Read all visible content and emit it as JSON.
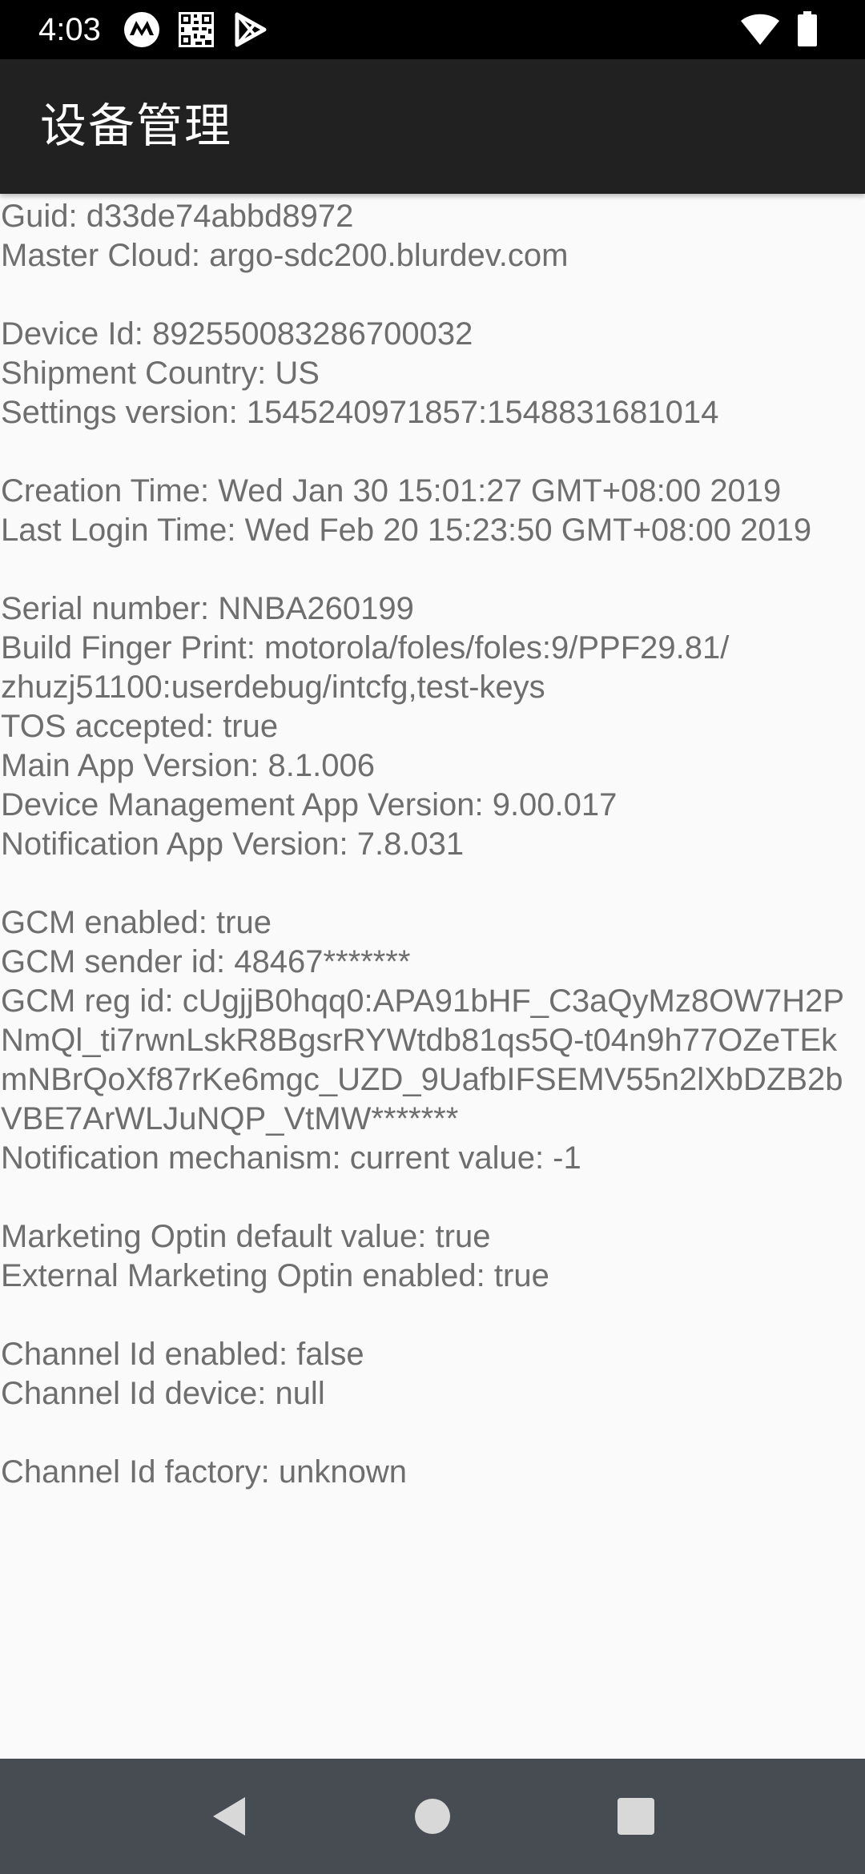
{
  "status_bar": {
    "time": "4:03",
    "icons": [
      "motorola-logo-icon",
      "qr-code-icon",
      "play-store-icon",
      "wifi-icon",
      "battery-icon"
    ]
  },
  "app_bar": {
    "title": "设备管理"
  },
  "info": {
    "guid": "Guid: d33de74abbd8972",
    "master_cloud": "Master Cloud: argo-sdc200.blurdev.com",
    "device_id": "Device Id: 892550083286700032",
    "shipment_country": "Shipment Country: US",
    "settings_version": "Settings version: 1545240971857:1548831681014",
    "creation_time": "Creation Time: Wed Jan 30 15:01:27 GMT+08:00 2019",
    "last_login_time": "Last Login Time: Wed Feb 20 15:23:50 GMT+08:00 2019",
    "serial_number": "Serial number: NNBA260199",
    "build_fingerprint_1": "Build Finger Print: motorola/foles/foles:9/PPF29.81/",
    "build_fingerprint_2": "zhuzj51100:userdebug/intcfg,test-keys",
    "tos_accepted": "TOS accepted: true",
    "main_app_version": "Main App Version: 8.1.006",
    "device_mgmt_app_version": "Device Management App Version: 9.00.017",
    "notification_app_version": "Notification App Version: 7.8.031",
    "gcm_enabled": "GCM enabled: true",
    "gcm_sender_id": "GCM sender id: 48467*******",
    "gcm_reg_id_1": "GCM reg id: cUgjjB0hqq0:APA91bHF_C3aQyMz8OW7H2P",
    "gcm_reg_id_2": "NmQl_ti7rwnLskR8BgsrRYWtdb81qs5Q-t04n9h77OZeTEk",
    "gcm_reg_id_3": "mNBrQoXf87rKe6mgc_UZD_9UafbIFSEMV55n2lXbDZB2b",
    "gcm_reg_id_4": "VBE7ArWLJuNQP_VtMW*******",
    "notification_mechanism": "Notification mechanism: current value: -1",
    "marketing_optin_default": "Marketing Optin default value: true",
    "external_marketing_optin": "External Marketing Optin enabled: true",
    "channel_id_enabled": "Channel Id enabled: false",
    "channel_id_device": "Channel Id device: null",
    "channel_id_factory": "Channel Id factory: unknown"
  },
  "nav_bar": {
    "buttons": [
      "back-icon",
      "home-icon",
      "recents-icon"
    ]
  },
  "colors": {
    "status_bar": "#000000",
    "app_bar": "#212121",
    "background": "#fafafa",
    "text": "#6e6e6e",
    "nav_bar": "#474b52"
  }
}
